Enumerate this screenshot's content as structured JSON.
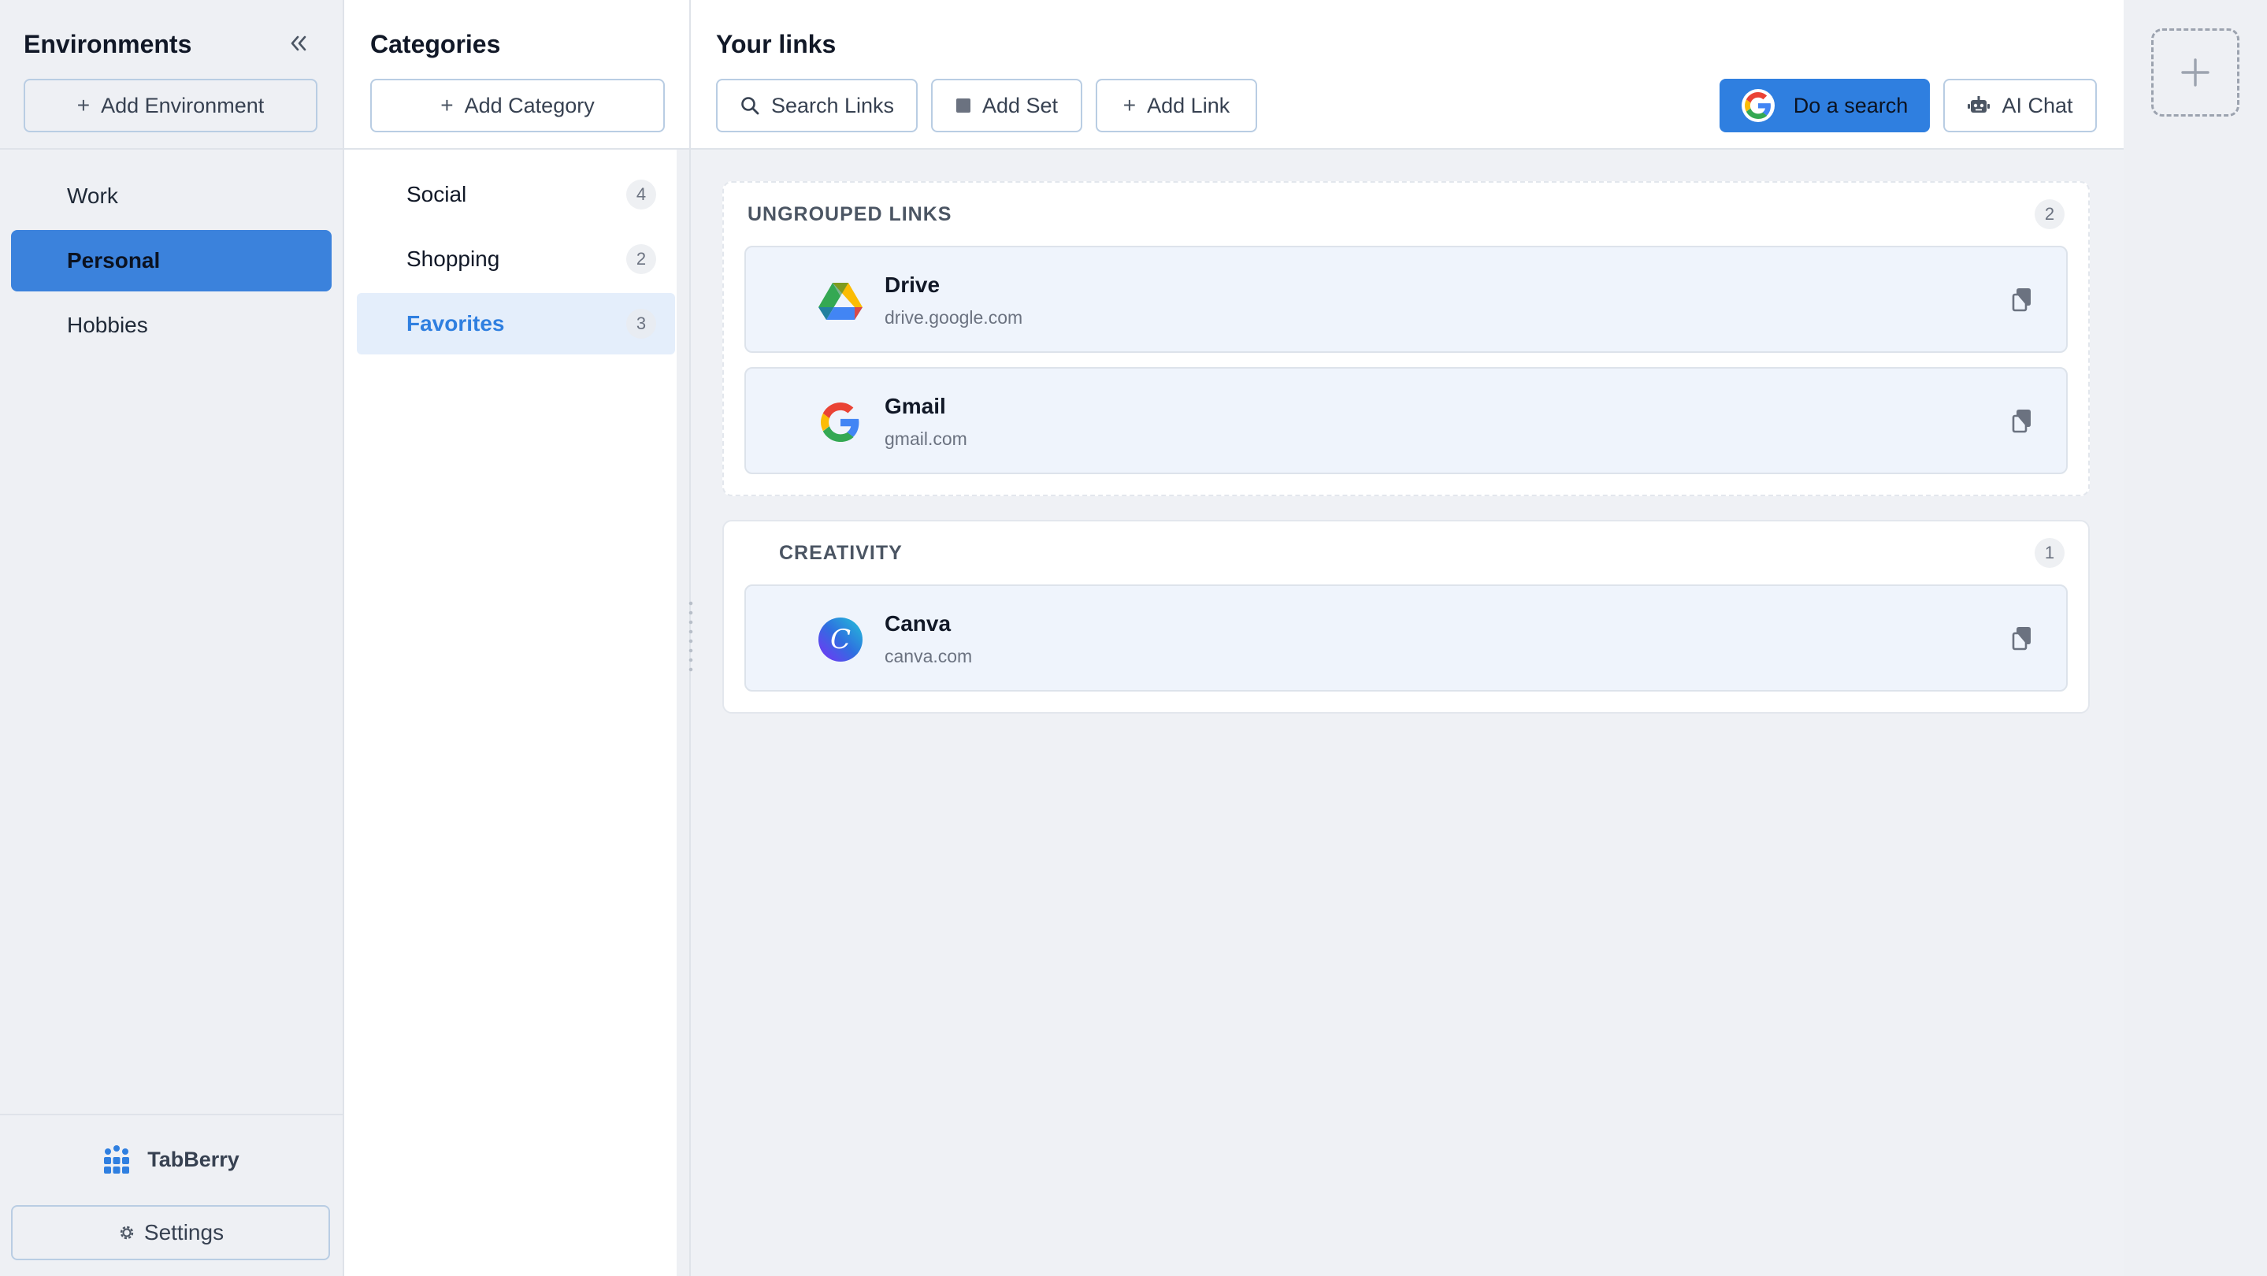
{
  "environments": {
    "title": "Environments",
    "add_label": "Add Environment",
    "items": [
      {
        "label": "Work"
      },
      {
        "label": "Personal"
      },
      {
        "label": "Hobbies"
      }
    ],
    "active_index": 1
  },
  "brand": {
    "name": "TabBerry"
  },
  "settings": {
    "label": "Settings"
  },
  "categories": {
    "title": "Categories",
    "add_label": "Add Category",
    "items": [
      {
        "label": "Social",
        "count": "4"
      },
      {
        "label": "Shopping",
        "count": "2"
      },
      {
        "label": "Favorites",
        "count": "3"
      }
    ],
    "active_index": 2
  },
  "links_panel": {
    "title": "Your links",
    "toolbar": {
      "search_label": "Search Links",
      "add_set_label": "Add Set",
      "add_link_label": "Add Link",
      "do_search_label": "Do a search",
      "ai_chat_label": "AI Chat"
    },
    "groups": [
      {
        "title": "UNGROUPED LINKS",
        "count": "2",
        "links": [
          {
            "name": "Drive",
            "url": "drive.google.com",
            "icon": "google-drive-logo"
          },
          {
            "name": "Gmail",
            "url": "gmail.com",
            "icon": "google-g-logo"
          }
        ]
      },
      {
        "title": "CREATIVITY",
        "count": "1",
        "links": [
          {
            "name": "Canva",
            "url": "canva.com",
            "icon": "canva-logo"
          }
        ]
      }
    ]
  },
  "colors": {
    "accent": "#2f7fe0",
    "active_env": "#3b82dc",
    "active_category_bg": "#e4eefb",
    "card_bg": "#eff4fc"
  }
}
